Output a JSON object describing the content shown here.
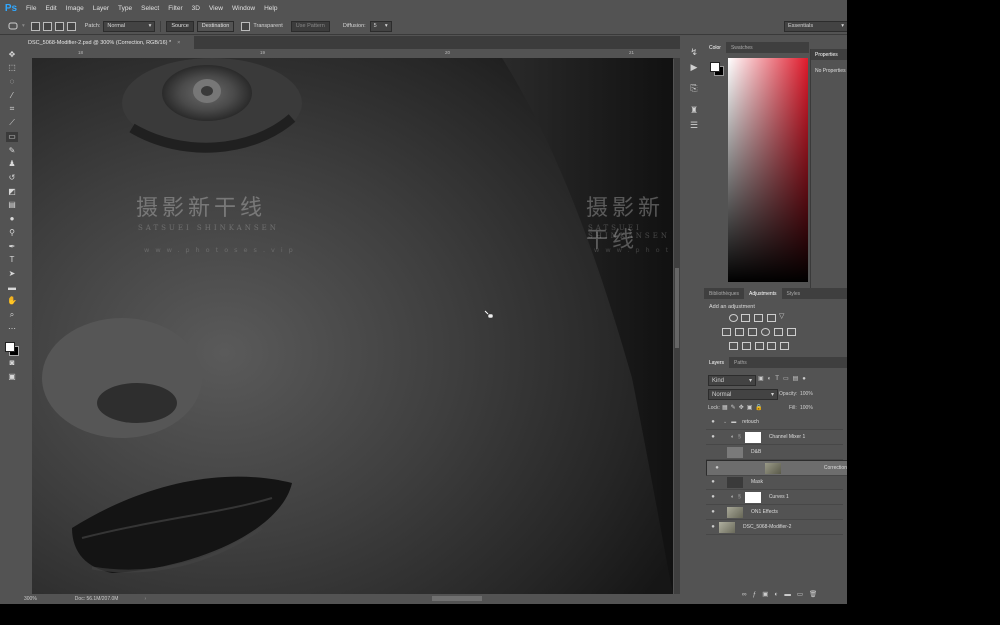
{
  "app": {
    "logo": "Ps"
  },
  "menu": [
    "File",
    "Edit",
    "Image",
    "Layer",
    "Type",
    "Select",
    "Filter",
    "3D",
    "View",
    "Window",
    "Help"
  ],
  "options": {
    "patch_label": "Patch:",
    "patch_mode": "Normal",
    "source": "Source",
    "destination": "Destination",
    "transparent": "Transparent",
    "use_pattern": "Use Pattern",
    "diffusion_label": "Diffusion:",
    "diffusion_value": "5",
    "workspace": "Essentials"
  },
  "document": {
    "tab_title": "DSC_5068-Modifier-2.psd @ 300% (Correction, RGB/16) *",
    "close": "×",
    "zoom": "300%",
    "doc_size": "Doc: 56.1M/207.0M"
  },
  "rulers": {
    "top": [
      "18",
      "19",
      "20",
      "21"
    ]
  },
  "watermarks": {
    "cn": "摄影新干线",
    "en": "SATSUEI SHINKANSEN",
    "url": "www.photoses.vip"
  },
  "color_panel": {
    "tabs": [
      "Color",
      "Swatches"
    ]
  },
  "properties": {
    "title": "Properties",
    "body": "No Properties"
  },
  "adjustments": {
    "tabs": [
      "Bibliothèques",
      "Adjustments",
      "Styles"
    ],
    "hint": "Add an adjustment"
  },
  "layers_panel": {
    "tabs": [
      "Layers",
      "Paths"
    ],
    "filter": "Kind",
    "blend": "Normal",
    "opacity_label": "Opacity:",
    "opacity": "100%",
    "lock_label": "Lock:",
    "fill_label": "Fill:",
    "fill": "100%",
    "layers": [
      {
        "name": "retouch",
        "kind": "group"
      },
      {
        "name": "Channel Mixer 1",
        "kind": "adjust"
      },
      {
        "name": "D&B",
        "kind": "gray"
      },
      {
        "name": "Correction",
        "kind": "photo",
        "selected": true
      },
      {
        "name": "Mask",
        "kind": "dark"
      },
      {
        "name": "Curves 1",
        "kind": "adjust"
      },
      {
        "name": "ON1 Effects",
        "kind": "photo"
      },
      {
        "name": "DSC_5068-Modifier-2",
        "kind": "photo"
      }
    ]
  }
}
